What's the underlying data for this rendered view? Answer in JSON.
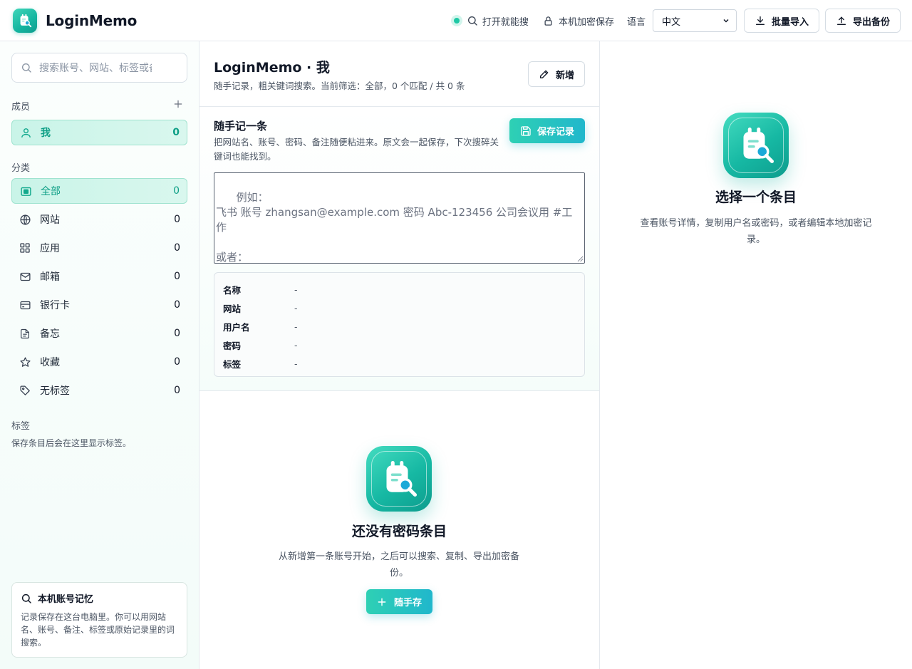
{
  "app": {
    "name": "LoginMemo"
  },
  "topbar": {
    "quick_search": "打开就能搜",
    "local_encrypt": "本机加密保存",
    "language_label": "语言",
    "language_value": "中文",
    "import_label": "批量导入",
    "export_label": "导出备份"
  },
  "sidebar": {
    "search_placeholder": "搜索账号、网站、标签或备注",
    "members_label": "成员",
    "members": [
      {
        "label": "我",
        "count": "0",
        "icon": "user-icon"
      }
    ],
    "categories_label": "分类",
    "categories": [
      {
        "label": "全部",
        "count": "0",
        "icon": "all-icon",
        "active": true
      },
      {
        "label": "网站",
        "count": "0",
        "icon": "globe-icon"
      },
      {
        "label": "应用",
        "count": "0",
        "icon": "grid-icon"
      },
      {
        "label": "邮箱",
        "count": "0",
        "icon": "mail-icon"
      },
      {
        "label": "银行卡",
        "count": "0",
        "icon": "card-icon"
      },
      {
        "label": "备忘",
        "count": "0",
        "icon": "note-icon"
      },
      {
        "label": "收藏",
        "count": "0",
        "icon": "star-icon"
      },
      {
        "label": "无标签",
        "count": "0",
        "icon": "tag-icon"
      }
    ],
    "tags_label": "标签",
    "tags_hint": "保存条目后会在这里显示标签。",
    "local_card": {
      "title": "本机账号记忆",
      "desc": "记录保存在这台电脑里。你可以用网站名、账号、备注、标签或原始记录里的词搜索。"
    }
  },
  "middle": {
    "title": "LoginMemo · 我",
    "subtitle": "随手记录，粗关键词搜索。当前筛选：全部，0 个匹配 / 共 0 条",
    "new_label": "新增",
    "quick": {
      "title": "随手记一条",
      "desc": "把网站名、账号、密码、备注随便粘进来。原文会一起保存，下次搜碎关键词也能找到。",
      "save_label": "保存记录",
      "placeholder": "例如：\n飞书 账号 zhangsan@example.com 密码 Abc-123456 公司会议用 #工作\n\n或者：\nOpenAI",
      "preview": [
        {
          "key": "名称",
          "value": "-"
        },
        {
          "key": "网站",
          "value": "-"
        },
        {
          "key": "用户名",
          "value": "-"
        },
        {
          "key": "密码",
          "value": "-"
        },
        {
          "key": "标签",
          "value": "-"
        }
      ]
    },
    "empty": {
      "title": "还没有密码条目",
      "desc": "从新增第一条账号开始，之后可以搜索、复制、导出加密备份。",
      "button": "随手存"
    }
  },
  "right": {
    "title": "选择一个条目",
    "desc": "查看账号详情，复制用户名或密码，或者编辑本地加密记录。"
  },
  "colors": {
    "accent": "#1ec8a5",
    "accent_2": "#20b7cc",
    "active_bg": "#c9f4e8"
  }
}
